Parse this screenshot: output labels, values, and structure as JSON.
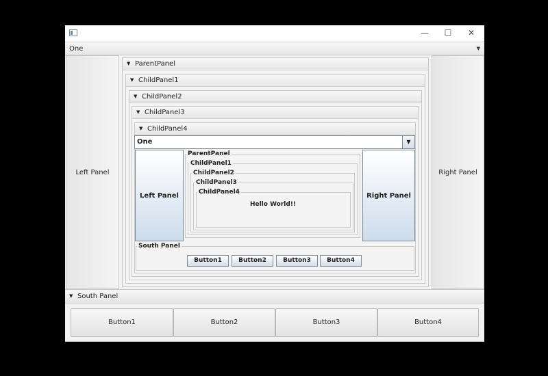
{
  "window": {
    "title": "",
    "controls": {
      "minimize": "—",
      "maximize": "☐",
      "close": "✕"
    }
  },
  "top_combo": {
    "value": "One",
    "arrow": "▼"
  },
  "left_panel": {
    "label": "Left Panel"
  },
  "right_panel": {
    "label": "Right Panel"
  },
  "titled_panes": [
    "ParentPanel",
    "ChildPanel1",
    "ChildPanel2",
    "ChildPanel3",
    "ChildPanel4"
  ],
  "pane_arrow": "▼",
  "swing": {
    "combo_value": "One",
    "combo_arrow": "▼",
    "left_panel": "Left Panel",
    "right_panel": "Right Panel",
    "titled_borders": [
      "ParentPanel",
      "ChildPanel1",
      "ChildPanel2",
      "ChildPanel3",
      "ChildPanel4"
    ],
    "message": "Hello World!!",
    "south_title": "South Panel",
    "buttons": [
      "Button1",
      "Button2",
      "Button3",
      "Button4"
    ]
  },
  "south_pane": {
    "title": "South Panel",
    "buttons": [
      "Button1",
      "Button2",
      "Button3",
      "Button4"
    ]
  }
}
